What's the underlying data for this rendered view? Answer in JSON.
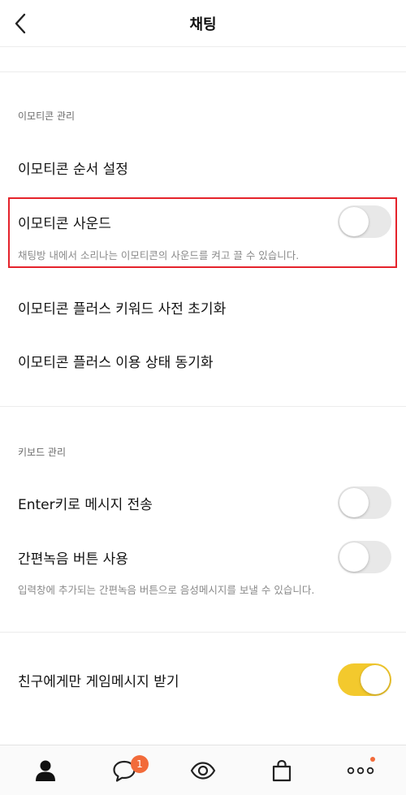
{
  "header": {
    "title": "채팅"
  },
  "emoticon_section": {
    "label": "이모티콘 관리",
    "order_setting": "이모티콘 순서 설정",
    "sound": {
      "title": "이모티콘 사운드",
      "description": "채팅방 내에서 소리나는 이모티콘의 사운드를 켜고 끌 수 있습니다.",
      "enabled": false
    },
    "plus_keyword_reset": "이모티콘 플러스 키워드 사전 초기화",
    "plus_sync": "이모티콘 플러스 이용 상태 동기화"
  },
  "keyboard_section": {
    "label": "키보드 관리",
    "enter_send": {
      "title": "Enter키로 메시지 전송",
      "enabled": false
    },
    "voice_button": {
      "title": "간편녹음 버튼 사용",
      "description": "입력창에 추가되는 간편녹음 버튼으로 음성메시지를 보낼 수 있습니다.",
      "enabled": false
    }
  },
  "friends_game": {
    "title": "친구에게만 게임메시지 받기",
    "enabled": true
  },
  "tabbar": {
    "tabs": [
      {
        "icon": "person-icon",
        "label": "friends"
      },
      {
        "icon": "chat-bubble-icon",
        "label": "chats",
        "badge": "1"
      },
      {
        "icon": "eye-icon",
        "label": "view"
      },
      {
        "icon": "shopping-bag-icon",
        "label": "shopping"
      },
      {
        "icon": "more-icon",
        "label": "more",
        "dot": true
      }
    ]
  },
  "colors": {
    "accent": "#f3c92d",
    "badge": "#f26b3a",
    "highlight": "#e5232b",
    "text": "#111111",
    "muted": "#8a8a8a"
  }
}
